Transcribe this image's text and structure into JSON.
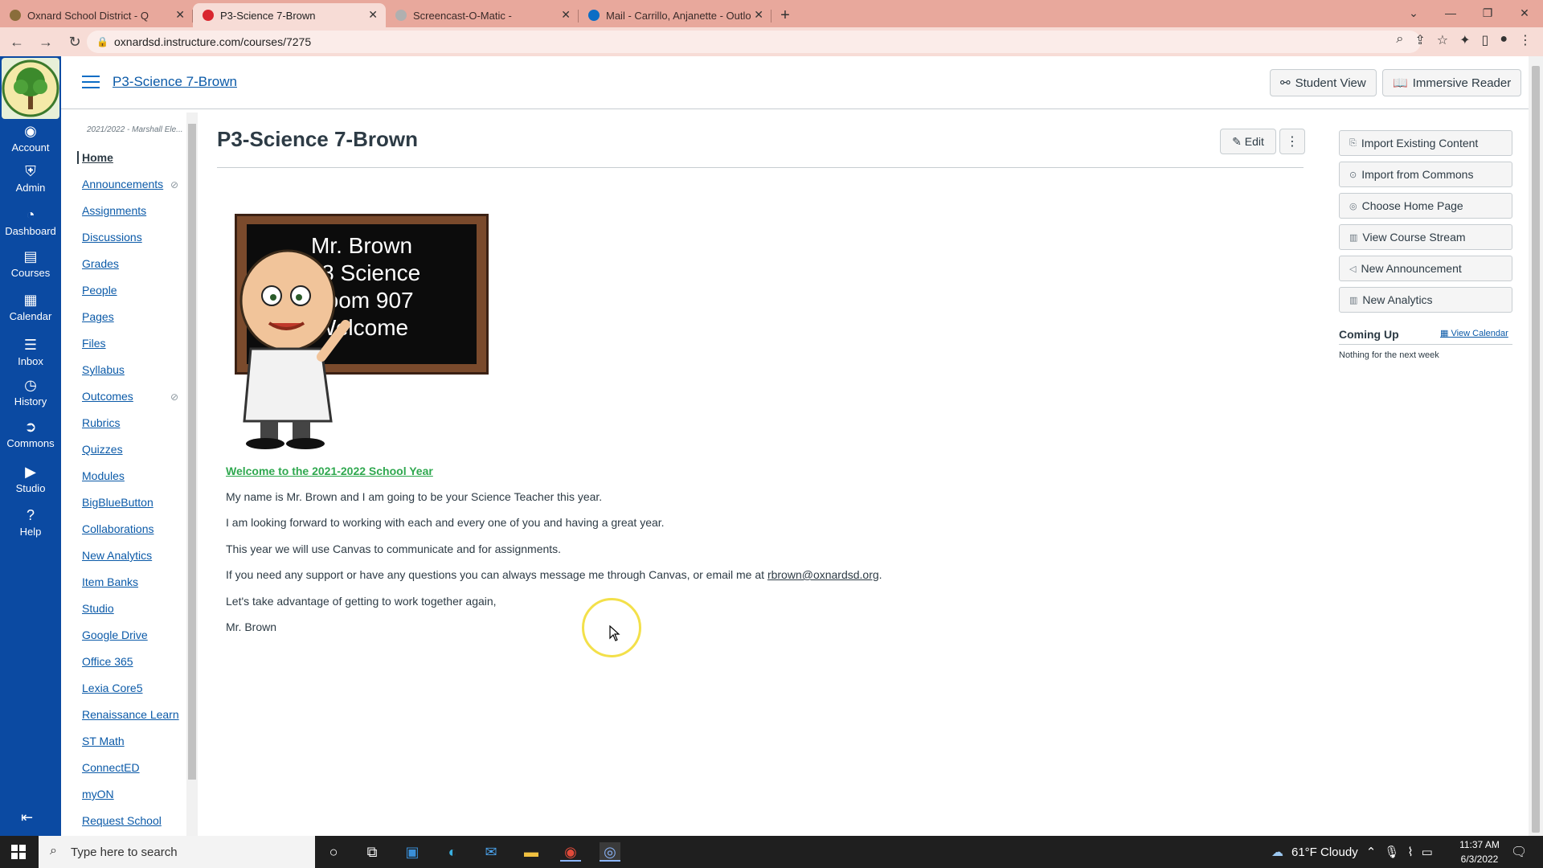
{
  "browser": {
    "tabs": [
      {
        "title": "Oxnard School District - Q",
        "active": false,
        "favicon_color": "#8a6d3b"
      },
      {
        "title": "P3-Science 7-Brown",
        "active": true,
        "favicon_color": "#d9262f"
      },
      {
        "title": "Screencast-O-Matic -",
        "active": false,
        "favicon_color": "#b0b0b0"
      },
      {
        "title": "Mail - Carrillo, Anjanette - Outlo",
        "active": false,
        "favicon_color": "#0b6dc5"
      }
    ],
    "url": "oxnardsd.instructure.com/courses/7275",
    "chrome_color": "#e8a89c"
  },
  "global_nav": {
    "color": "#0b4aa2",
    "items": [
      {
        "label": "Account",
        "icon": "account-icon"
      },
      {
        "label": "Admin",
        "icon": "admin-icon"
      },
      {
        "label": "Dashboard",
        "icon": "dashboard-icon"
      },
      {
        "label": "Courses",
        "icon": "courses-icon"
      },
      {
        "label": "Calendar",
        "icon": "calendar-icon"
      },
      {
        "label": "Inbox",
        "icon": "inbox-icon"
      },
      {
        "label": "History",
        "icon": "history-icon"
      },
      {
        "label": "Commons",
        "icon": "commons-icon"
      },
      {
        "label": "Studio",
        "icon": "studio-icon"
      },
      {
        "label": "Help",
        "icon": "help-icon"
      }
    ]
  },
  "header": {
    "breadcrumb": "P3-Science 7-Brown",
    "student_view": "Student View",
    "immersive_reader": "Immersive Reader"
  },
  "course_nav": {
    "term": "2021/2022 - Marshall Ele...",
    "items": [
      {
        "label": "Home",
        "hidden": false
      },
      {
        "label": "Announcements",
        "hidden": true
      },
      {
        "label": "Assignments",
        "hidden": false
      },
      {
        "label": "Discussions",
        "hidden": false
      },
      {
        "label": "Grades",
        "hidden": false
      },
      {
        "label": "People",
        "hidden": false
      },
      {
        "label": "Pages",
        "hidden": false
      },
      {
        "label": "Files",
        "hidden": false
      },
      {
        "label": "Syllabus",
        "hidden": false
      },
      {
        "label": "Outcomes",
        "hidden": true
      },
      {
        "label": "Rubrics",
        "hidden": false
      },
      {
        "label": "Quizzes",
        "hidden": false
      },
      {
        "label": "Modules",
        "hidden": false
      },
      {
        "label": "BigBlueButton",
        "hidden": false
      },
      {
        "label": "Collaborations",
        "hidden": false
      },
      {
        "label": "New Analytics",
        "hidden": false
      },
      {
        "label": "Item Banks",
        "hidden": false
      },
      {
        "label": "Studio",
        "hidden": false
      },
      {
        "label": "Google Drive",
        "hidden": false
      },
      {
        "label": "Office 365",
        "hidden": false
      },
      {
        "label": "Lexia Core5",
        "hidden": false
      },
      {
        "label": "Renaissance Learn",
        "hidden": false
      },
      {
        "label": "ST Math",
        "hidden": false
      },
      {
        "label": "ConnectED",
        "hidden": false
      },
      {
        "label": "myON",
        "hidden": false
      },
      {
        "label": "Request School",
        "hidden": false
      }
    ]
  },
  "main": {
    "title": "P3-Science 7-Brown",
    "edit": "Edit",
    "board_lines": [
      "Mr. Brown",
      "7/8 Science",
      "Room 907",
      "Welcome"
    ],
    "welcome_link": "Welcome to the 2021-2022 School Year",
    "paragraphs": [
      "My name is Mr. Brown and I am going to be your Science Teacher this year.",
      "I am looking forward to working with each and every one of you and having a great year.",
      "This year we will use Canvas to communicate and for assignments."
    ],
    "support_text": "If you need any support or have any questions you can always message me through Canvas, or email me at ",
    "email": "rbrown@oxnardsd.org",
    "support_end": ".",
    "closing": "Let's take advantage of getting to work together again,",
    "signature": "Mr. Brown"
  },
  "sidebar": {
    "buttons": [
      {
        "label": "Import Existing Content",
        "icon": "import-icon"
      },
      {
        "label": "Import from Commons",
        "icon": "commons-icon"
      },
      {
        "label": "Choose Home Page",
        "icon": "home-page-icon"
      },
      {
        "label": "View Course Stream",
        "icon": "stream-icon"
      },
      {
        "label": "New Announcement",
        "icon": "announcement-icon"
      },
      {
        "label": "New Analytics",
        "icon": "analytics-icon"
      }
    ],
    "coming_up": "Coming Up",
    "view_calendar": "View Calendar",
    "nothing": "Nothing for the next week"
  },
  "taskbar": {
    "search_placeholder": "Type here to search",
    "weather": "61°F  Cloudy",
    "time": "11:37 AM",
    "date": "6/3/2022"
  }
}
